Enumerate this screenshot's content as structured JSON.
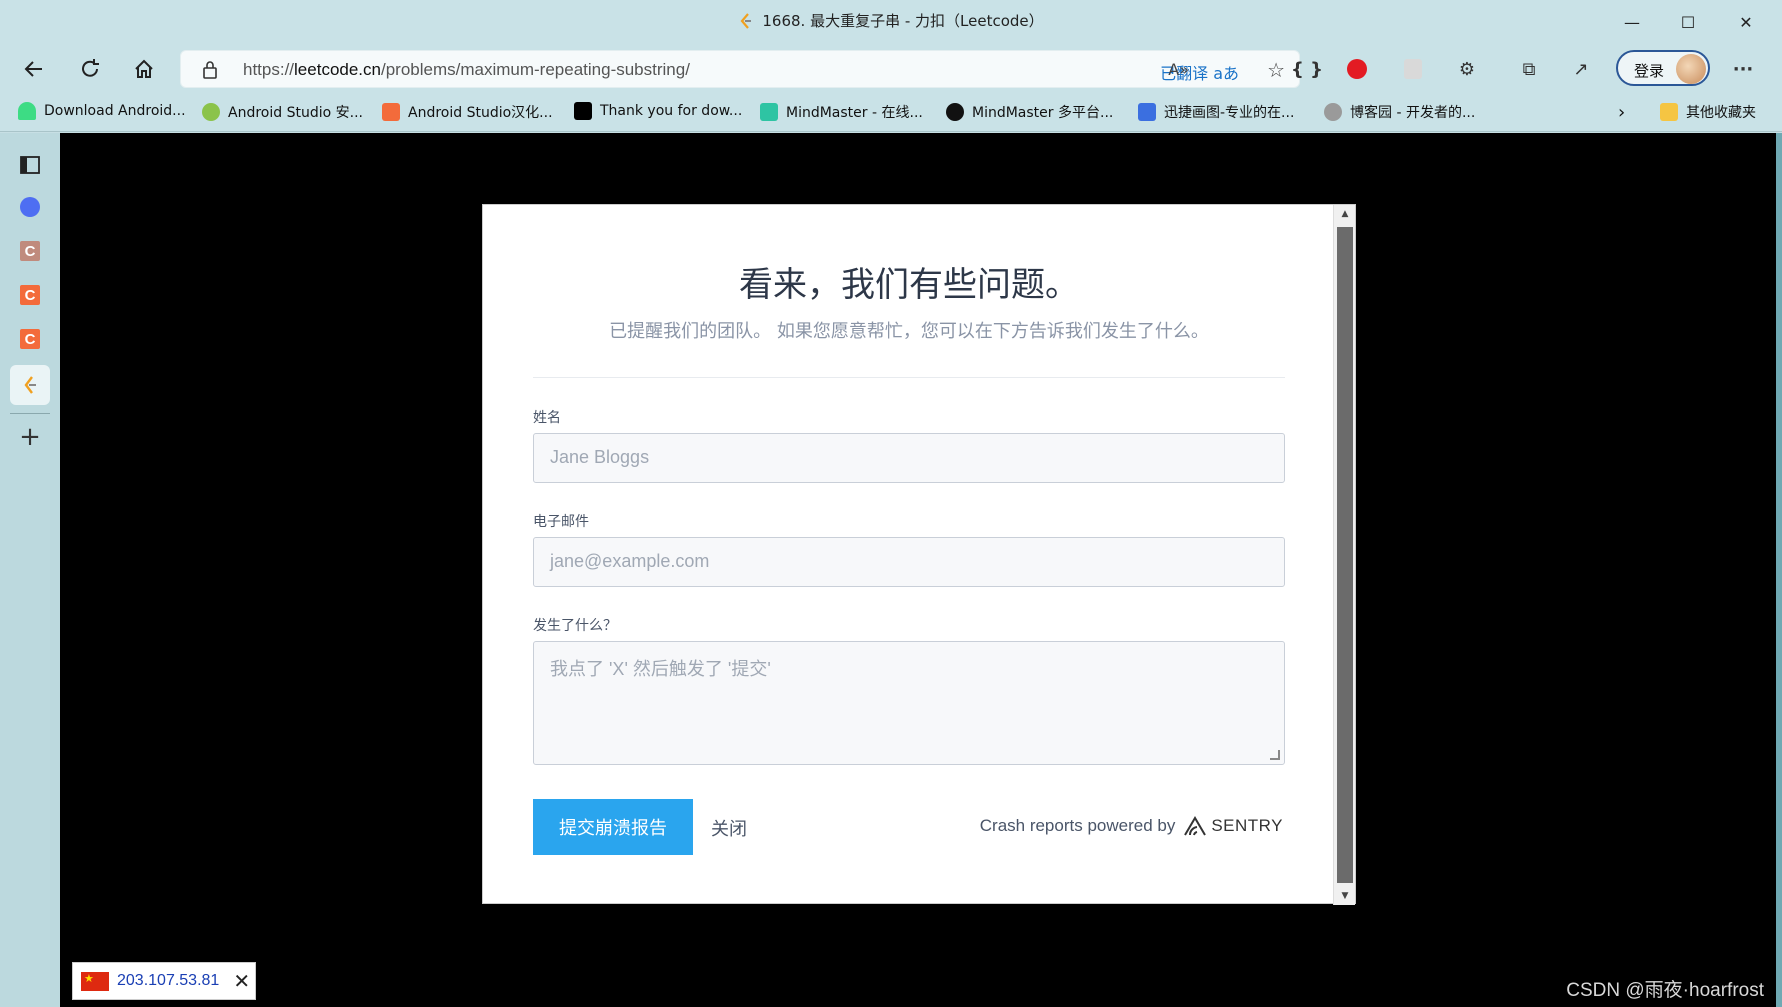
{
  "window": {
    "title": "1668. 最大重复子串 - 力扣（Leetcode）",
    "minimize": "—",
    "maximize": "☐",
    "close": "✕"
  },
  "navbar": {
    "url_prefix": "https://",
    "url_host": "leetcode.cn",
    "url_path": "/problems/maximum-repeating-substring/",
    "translated_label": "已翻译",
    "login_label": "登录"
  },
  "bookmarks": [
    {
      "label": "Download Android...",
      "icon": "android-icon",
      "color": "#3ddc84"
    },
    {
      "label": "Android Studio 安...",
      "icon": "android-studio-icon",
      "color": "#8bc34a"
    },
    {
      "label": "Android Studio汉化...",
      "icon": "csdn-icon",
      "color": "#f36b3b"
    },
    {
      "label": "Thank you for dow...",
      "icon": "jetbrains-icon",
      "color": "#000000"
    },
    {
      "label": "MindMaster - 在线...",
      "icon": "mindmaster-icon",
      "color": "#2ec4a3"
    },
    {
      "label": "MindMaster 多平台...",
      "icon": "mindmaster-d-icon",
      "color": "#111111"
    },
    {
      "label": "迅捷画图-专业的在...",
      "icon": "xunjie-icon",
      "color": "#3b6fe0"
    },
    {
      "label": "博客园 - 开发者的...",
      "icon": "cnblogs-icon",
      "color": "#666666"
    }
  ],
  "bookmarks_other": "其他收藏夹",
  "dialog": {
    "title": "看来，我们有些问题。",
    "subtitle": "已提醒我们的团队。 如果您愿意帮忙，您可以在下方告诉我们发生了什么。",
    "name_label": "姓名",
    "name_placeholder": "Jane Bloggs",
    "email_label": "电子邮件",
    "email_placeholder": "jane@example.com",
    "comments_label": "发生了什么？",
    "comments_placeholder": "我点了 'X' 然后触发了 '提交'",
    "submit_label": "提交崩溃报告",
    "close_label": "关闭",
    "powered_by": "Crash reports powered by",
    "sentry": "SENTRY"
  },
  "ip_badge": {
    "ip": "203.107.53.81"
  },
  "watermark": "CSDN @雨夜·hoarfrost",
  "colors": {
    "accent": "#2aa5ee",
    "chrome": "#c9e2e7",
    "backdrop": "#000000"
  }
}
